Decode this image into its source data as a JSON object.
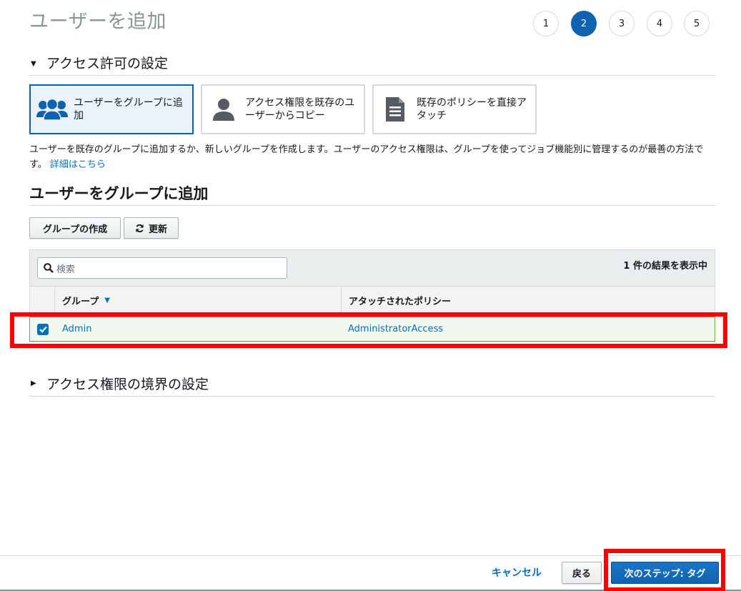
{
  "page": {
    "title": "ユーザーを追加",
    "steps": [
      "1",
      "2",
      "3",
      "4",
      "5"
    ],
    "active_step": "2"
  },
  "permissions_section": {
    "title": "アクセス許可の設定",
    "options": [
      {
        "label": "ユーザーをグループに追加",
        "icon": "user-group-icon",
        "selected": true
      },
      {
        "label": "アクセス権限を既存のユーザーからコピー",
        "icon": "user-icon",
        "selected": false
      },
      {
        "label": "既存のポリシーを直接アタッチ",
        "icon": "document-icon",
        "selected": false
      }
    ],
    "description": "ユーザーを既存のグループに追加するか、新しいグループを作成します。ユーザーのアクセス権限は、グループを使ってジョブ機能別に管理するのが最善の方法です。",
    "more_link": "詳細はこちら"
  },
  "group_section": {
    "title": "ユーザーをグループに追加",
    "create_group_label": "グループの作成",
    "refresh_label": "更新",
    "search_placeholder": "検索",
    "result_count": "1 件の結果を表示中",
    "columns": [
      "グループ",
      "アタッチされたポリシー"
    ],
    "rows": [
      {
        "group": "Admin",
        "policy": "AdministratorAccess",
        "checked": true
      }
    ]
  },
  "boundary_section": {
    "title": "アクセス権限の境界の設定"
  },
  "footer": {
    "cancel_label": "キャンセル",
    "back_label": "戻る",
    "next_label": "次のステップ: タグ"
  },
  "colors": {
    "primary": "#0f62af",
    "link": "#0073bb",
    "highlight": "#ff0000",
    "selected_row_border": "#6aaf35"
  }
}
